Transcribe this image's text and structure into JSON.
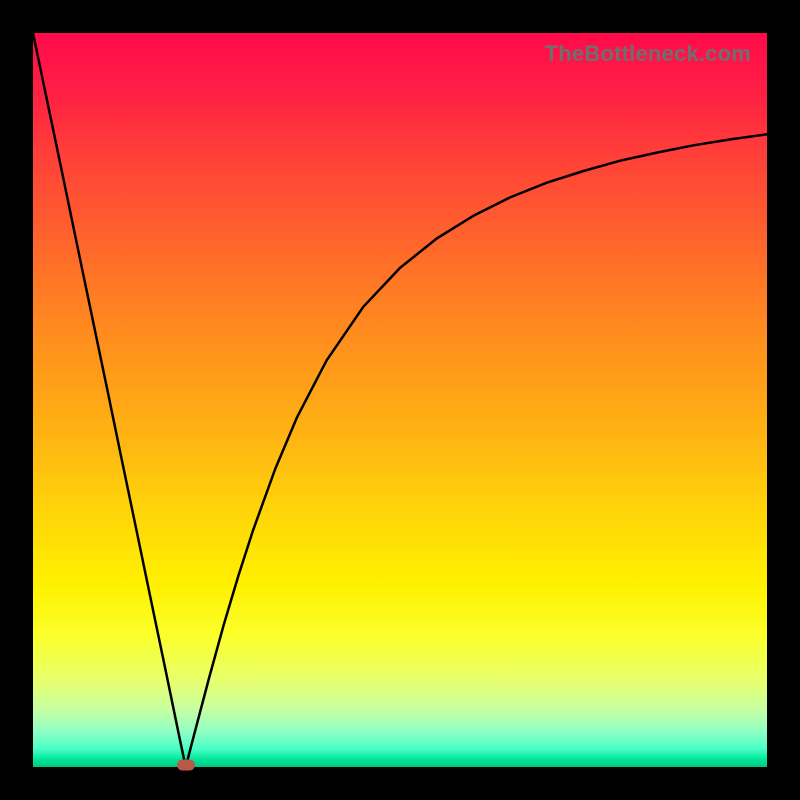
{
  "watermark": "TheBottleneck.com",
  "chart_data": {
    "type": "line",
    "title": "",
    "xlabel": "",
    "ylabel": "",
    "xlim": [
      0,
      100
    ],
    "ylim": [
      0,
      100
    ],
    "grid": false,
    "legend": false,
    "colors": {
      "gradient_top": "#ff0a4a",
      "gradient_bottom": "#00c880",
      "curve": "#000000",
      "marker": "#b85a4a",
      "frame": "#000000"
    },
    "marker": {
      "x": 20.8,
      "valley_x": 20.8
    },
    "series": [
      {
        "name": "bottleneck-curve",
        "x": [
          0,
          2,
          4,
          6,
          8,
          10,
          12,
          14,
          16,
          18,
          20,
          20.8,
          22,
          24,
          26,
          28,
          30,
          33,
          36,
          40,
          45,
          50,
          55,
          60,
          65,
          70,
          75,
          80,
          85,
          90,
          95,
          100
        ],
        "y": [
          100,
          90.4,
          80.8,
          71.2,
          61.6,
          52.0,
          42.3,
          32.7,
          23.1,
          13.5,
          3.8,
          0,
          4.6,
          12.2,
          19.4,
          26.1,
          32.3,
          40.6,
          47.7,
          55.4,
          62.7,
          68.0,
          72.0,
          75.1,
          77.6,
          79.6,
          81.2,
          82.6,
          83.7,
          84.7,
          85.5,
          86.2
        ]
      }
    ]
  }
}
